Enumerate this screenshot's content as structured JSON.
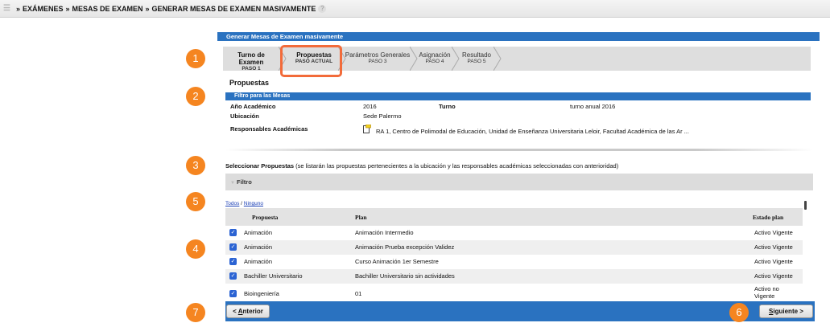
{
  "breadcrumb": {
    "items": [
      "EXÁMENES",
      "MESAS DE EXAMEN",
      "GENERAR MESAS DE EXAMEN MASIVAMENTE"
    ],
    "separator": "»",
    "help": "?"
  },
  "panel": {
    "title": "Generar Mesas de Examen masivamente"
  },
  "wizard": {
    "steps": [
      {
        "name": "Turno de Examen",
        "sub": "PASO 1"
      },
      {
        "name": "Propuestas",
        "sub": "PASO ACTUAL"
      },
      {
        "name": "Parámetros Generales",
        "sub": "PASO 3"
      },
      {
        "name": "Asignación",
        "sub": "PASO 4"
      },
      {
        "name": "Resultado",
        "sub": "PASO 5"
      }
    ]
  },
  "section": {
    "title": "Propuestas"
  },
  "filter_mesas": {
    "header": "Filtro para las Mesas",
    "anio_label": "Año Académico",
    "anio_value": "2016",
    "turno_label": "Turno",
    "turno_value": "turno anual 2016",
    "ubicacion_label": "Ubicación",
    "ubicacion_value": "Sede Palermo",
    "responsables_label": "Responsables Académicas",
    "responsables_value": "RA 1, Centro de Polimodal de Educación, Unidad de Enseñanza Universitaria Leloir, Facultad Académica de las Ar ..."
  },
  "select_propuestas": {
    "label": "Seleccionar Propuestas",
    "note": "(se listarán las propuestas pertenecientes a la ubicación y las responsables académicas seleccionadas con anterioridad)"
  },
  "filtro_bar": {
    "label": "Filtro",
    "arrow": "▼"
  },
  "links": {
    "todos": "Todos",
    "sep": "/",
    "ninguno": "Ninguno"
  },
  "table": {
    "headers": {
      "propuesta": "Propuesta",
      "plan": "Plan",
      "estado": "Estado plan"
    },
    "rows": [
      {
        "propuesta": "Animación",
        "plan": "Animación Intermedio",
        "estado": "Activo Vigente"
      },
      {
        "propuesta": "Animación",
        "plan": "Animación Prueba excepción Validez",
        "estado": "Activo Vigente"
      },
      {
        "propuesta": "Animación",
        "plan": "Curso Animación 1er Semestre",
        "estado": "Activo Vigente"
      },
      {
        "propuesta": "Bachiller Universitario",
        "plan": "Bachiller Universitario sin actividades",
        "estado": "Activo Vigente"
      },
      {
        "propuesta": "Bioingeniería",
        "plan": "01",
        "estado": "Activo no Vigente"
      }
    ]
  },
  "footer": {
    "prev_label": "< ",
    "prev_key": "A",
    "prev_rest": "nterior",
    "next_key": "S",
    "next_rest": "iguiente >"
  },
  "badges": [
    "1",
    "2",
    "3",
    "4",
    "5",
    "6",
    "7"
  ],
  "colors": {
    "header_blue": "#2a72c0",
    "badge_orange": "#f58520",
    "highlight": "#f26b3a"
  }
}
